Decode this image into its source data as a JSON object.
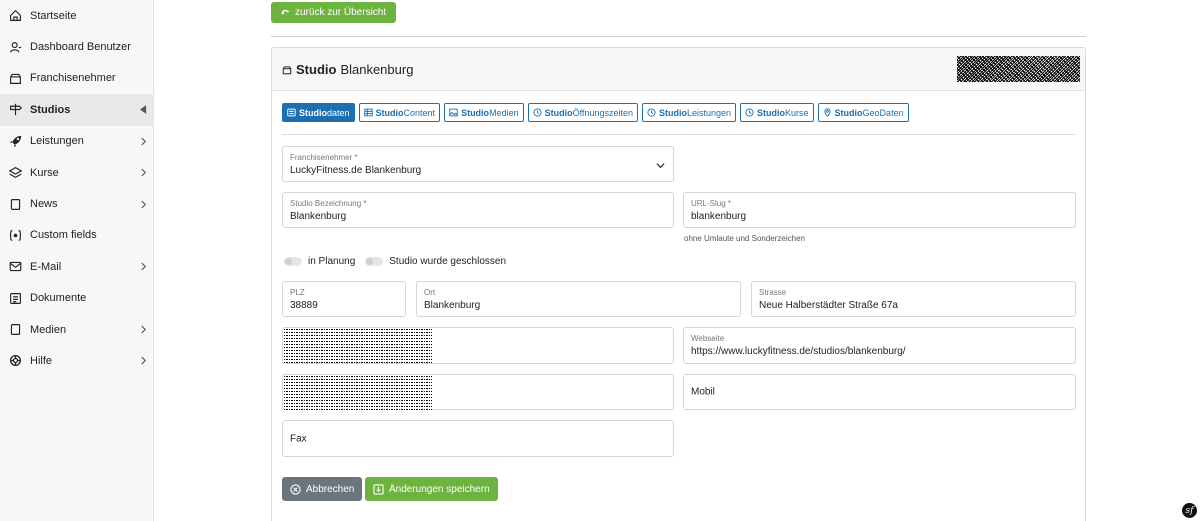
{
  "sidebar": {
    "items": [
      {
        "label": "Startseite",
        "icon": "home-icon"
      },
      {
        "label": "Dashboard Benutzer",
        "icon": "user-icon"
      },
      {
        "label": "Franchisenehmer",
        "icon": "building-icon"
      },
      {
        "label": "Studios",
        "icon": "signpost-icon",
        "active": true
      },
      {
        "label": "Leistungen",
        "icon": "rocket-icon"
      },
      {
        "label": "Kurse",
        "icon": "layers-icon"
      },
      {
        "label": "News",
        "icon": "document-icon"
      },
      {
        "label": "Custom fields",
        "icon": "brackets-icon"
      },
      {
        "label": "E-Mail",
        "icon": "mail-icon"
      },
      {
        "label": "Dokumente",
        "icon": "file-text-icon"
      },
      {
        "label": "Medien",
        "icon": "media-icon"
      },
      {
        "label": "Hilfe",
        "icon": "lifebuoy-icon"
      }
    ]
  },
  "back_button": "zurück zur Übersicht",
  "card": {
    "title_bold": "Studio",
    "title_rest": "Blankenburg"
  },
  "tabs": [
    {
      "bold": "Studio",
      "rest": "daten",
      "icon": "list-icon",
      "active": true
    },
    {
      "bold": "Studio",
      "rest": "Content",
      "icon": "table-icon"
    },
    {
      "bold": "Studio",
      "rest": "Medien",
      "icon": "image-icon"
    },
    {
      "bold": "Studio",
      "rest": " Öffnungszeiten",
      "icon": "clock-icon"
    },
    {
      "bold": "Studio",
      "rest": " Leistungen",
      "icon": "clock-icon"
    },
    {
      "bold": "Studio",
      "rest": " Kurse",
      "icon": "clock-icon"
    },
    {
      "bold": "Studio",
      "rest": " GeoDaten",
      "icon": "map-pin-icon"
    }
  ],
  "form": {
    "franchisenehmer": {
      "label": "Franchisenehmer *",
      "value": "LuckyFitness.de Blankenburg"
    },
    "bezeichnung": {
      "label": "Studio Bezeichnung *",
      "value": "Blankenburg"
    },
    "slug": {
      "label": "URL-Slug *",
      "value": "blankenburg",
      "hint": "ohne Umlaute und Sonderzeichen"
    },
    "toggle_planung": "in Planung",
    "toggle_geschlossen": "Studio wurde geschlossen",
    "plz": {
      "label": "PLZ",
      "value": "38889"
    },
    "ort": {
      "label": "Ort",
      "value": "Blankenburg"
    },
    "strasse": {
      "label": "Strasse",
      "value": "Neue Halberstädter Straße 67a"
    },
    "webseite": {
      "label": "Webseite",
      "value": "https://www.luckyfitness.de/studios/blankenburg/"
    },
    "mobil": {
      "placeholder": "Mobil"
    },
    "fax": {
      "placeholder": "Fax"
    }
  },
  "buttons": {
    "cancel": "Abbrechen",
    "save": "Änderungen speichern"
  },
  "colors": {
    "accent_green": "#6db33f",
    "tab_blue": "#1e6fb0",
    "cancel_gray": "#6c757d"
  }
}
